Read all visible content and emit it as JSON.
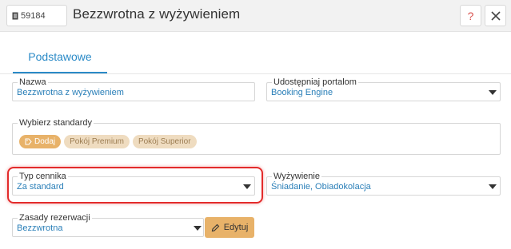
{
  "header": {
    "id": "59184",
    "title": "Bezzwrotna z wyżywieniem",
    "help_label": "?",
    "icons": {
      "id": "document-icon",
      "help": "question-icon",
      "close": "close-icon"
    }
  },
  "tabs": [
    {
      "label": "Podstawowe",
      "active": true
    }
  ],
  "form": {
    "name": {
      "label": "Nazwa",
      "value": "Bezzwrotna z wyżywieniem"
    },
    "portal": {
      "label": "Udostępniaj portalom",
      "value": "Booking Engine"
    },
    "standards": {
      "label": "Wybierz standardy",
      "add_label": "Dodaj",
      "items": [
        "Pokój Premium",
        "Pokój Superior"
      ]
    },
    "price_list_type": {
      "label": "Typ cennika",
      "value": "Za standard"
    },
    "meals": {
      "label": "Wyżywienie",
      "value": "Śniadanie, Obiadokolacja"
    },
    "booking_rules": {
      "label": "Zasady rezerwacji",
      "value": "Bezzwrotna",
      "edit_label": "Edytuj"
    }
  },
  "colors": {
    "accent": "#2a8ac7",
    "tag": "#e8b269",
    "highlight": "#e32b2b"
  }
}
